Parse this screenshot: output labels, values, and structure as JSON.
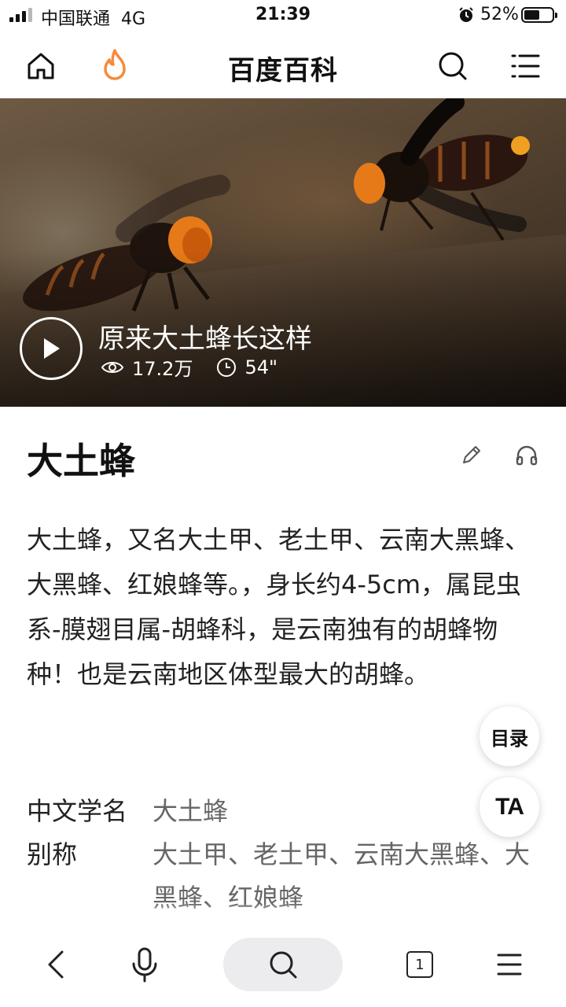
{
  "status_bar": {
    "carrier": "中国联通",
    "network": "4G",
    "time": "21:39",
    "battery": "52%"
  },
  "header": {
    "title": "百度百科"
  },
  "video": {
    "title": "原来大土蜂长这样",
    "views": "17.2万",
    "duration": "54\""
  },
  "article": {
    "title": "大土蜂",
    "summary": "大土蜂，又名大土甲、老土甲、云南大黑蜂、大黑蜂、红娘蜂等。，身长约4-5cm，属昆虫系-膜翅目属-胡蜂科，是云南独有的胡蜂物种！也是云南地区体型最大的胡蜂。",
    "info": [
      {
        "key": "中文学名",
        "value": "大土蜂"
      },
      {
        "key": "别称",
        "value": "大土甲、老土甲、云南大黑蜂、大黑蜂、红娘蜂"
      }
    ],
    "partial_next": "目"
  },
  "floating": {
    "toc": "目录",
    "ta": "TA"
  },
  "bottom_bar": {
    "tab_count": "1"
  },
  "colors": {
    "accent_orange": "#F58A3A",
    "text": "#222222",
    "muted": "#666666"
  }
}
